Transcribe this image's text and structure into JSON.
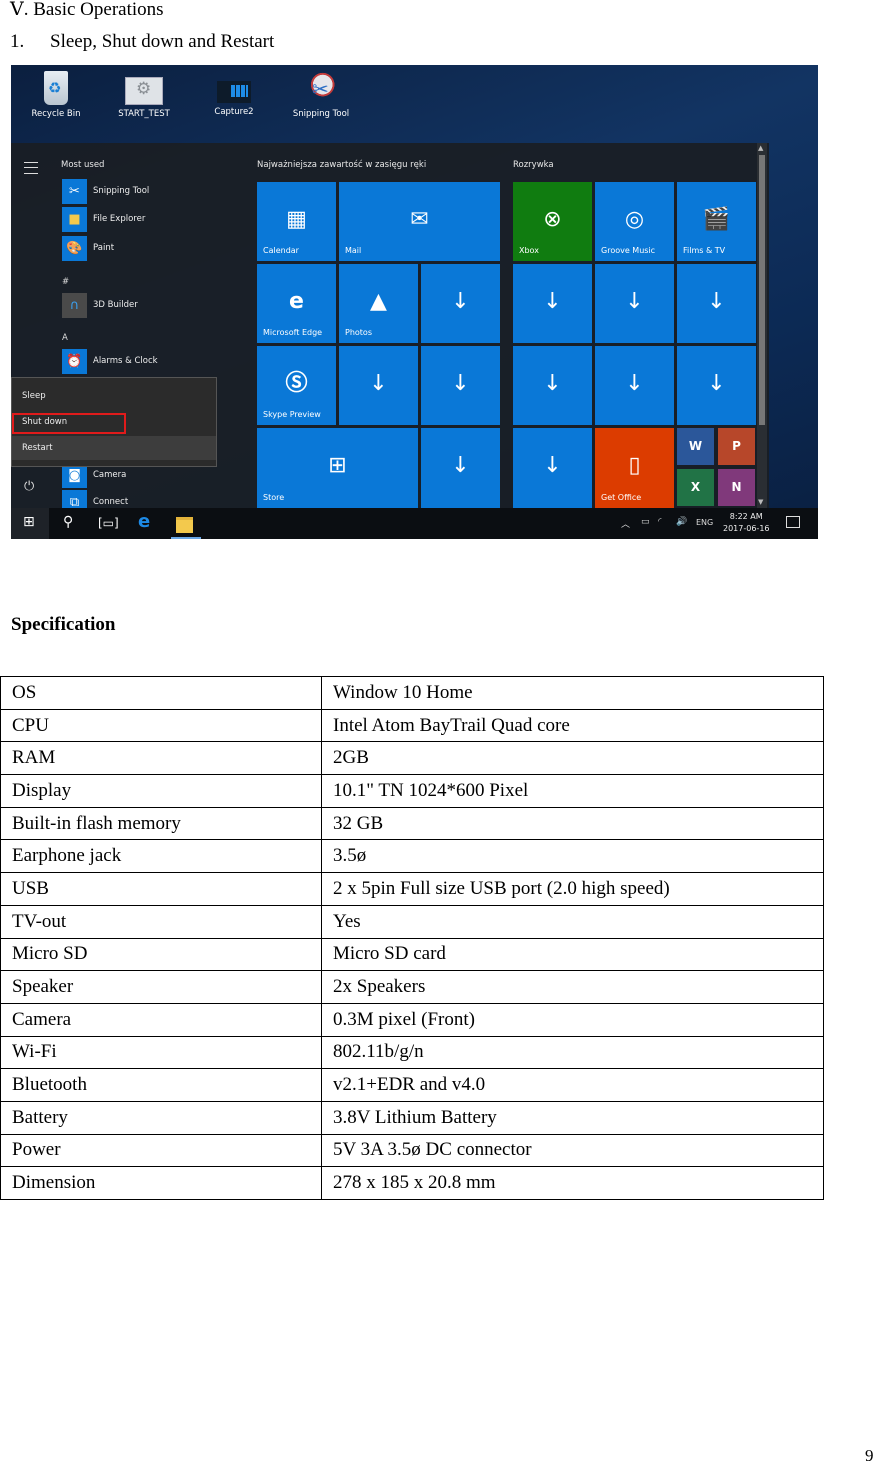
{
  "doc": {
    "section_heading": "Ⅴ. Basic Operations",
    "subsection_number": "1.",
    "subsection_title": "Sleep, Shut down and Restart",
    "spec_title": "Specification",
    "page_number": "9"
  },
  "screenshot": {
    "desktop_icons": [
      {
        "label": "Recycle Bin",
        "icon": "recycle-bin-icon"
      },
      {
        "label": "START_TEST",
        "icon": "settings-window-icon"
      },
      {
        "label": "Capture2",
        "icon": "image-file-icon"
      },
      {
        "label": "Snipping Tool",
        "icon": "snipping-tool-icon"
      }
    ],
    "start_menu": {
      "most_used_label": "Most used",
      "apps": [
        {
          "label": "Snipping Tool",
          "icon": "snipping-tool-icon"
        },
        {
          "label": "File Explorer",
          "icon": "folder-icon"
        },
        {
          "label": "Paint",
          "icon": "paint-icon"
        },
        {
          "label": "3D Builder",
          "icon": "3d-builder-icon"
        },
        {
          "label": "Alarms & Clock",
          "icon": "alarm-clock-icon"
        },
        {
          "label": "Camera",
          "icon": "camera-icon"
        },
        {
          "label": "Connect",
          "icon": "connect-icon"
        }
      ],
      "letters": [
        "#",
        "A"
      ],
      "power_menu": {
        "items": [
          "Sleep",
          "Shut down",
          "Restart"
        ],
        "highlighted": "Shut down",
        "highlight_color": "#e01b1b"
      },
      "groups": [
        {
          "title": "Najważniejsza zawartość w zasięgu ręki"
        },
        {
          "title": "Rozrywka"
        }
      ],
      "tiles": {
        "calendar": "Calendar",
        "mail": "Mail",
        "edge": "Microsoft Edge",
        "photos": "Photos",
        "skype": "Skype Preview",
        "store": "Store",
        "xbox": "Xbox",
        "groove": "Groove Music",
        "films": "Films & TV",
        "office": "Get Office",
        "download_glyph": "↓"
      },
      "office_minis": [
        "W",
        "P",
        "X",
        "N"
      ],
      "colors": {
        "tile_blue": "#0a78d7",
        "xbox_green": "#107c10",
        "office_orange": "#dc3c00",
        "word": "#2b579a",
        "powerpoint": "#b7472a",
        "excel": "#217346",
        "onenote": "#80397b"
      }
    },
    "taskbar": {
      "language": "ENG",
      "time": "8:22 AM",
      "date": "2017-06-16"
    }
  },
  "spec_table": {
    "rows": [
      {
        "key": "OS",
        "value": "Window 10 Home"
      },
      {
        "key": "CPU",
        "value": "Intel Atom BayTrail Quad core"
      },
      {
        "key": "RAM",
        "value": "2GB"
      },
      {
        "key": "Display",
        "value": "10.1\" TN 1024*600 Pixel"
      },
      {
        "key": "Built-in flash memory",
        "value": "32 GB"
      },
      {
        "key": "Earphone jack",
        "value": "3.5ø"
      },
      {
        "key": "USB",
        "value": "2 x 5pin Full size USB port (2.0 high speed)"
      },
      {
        "key": "TV-out",
        "value": "Yes"
      },
      {
        "key": "Micro SD",
        "value": "Micro SD card"
      },
      {
        "key": "Speaker",
        "value": "2x Speakers"
      },
      {
        "key": "Camera",
        "value": "0.3M pixel (Front)"
      },
      {
        "key": "Wi-Fi",
        "value": "802.11b/g/n"
      },
      {
        "key": "Bluetooth",
        "value": "v2.1+EDR and v4.0"
      },
      {
        "key": "Battery",
        "value": "3.8V Lithium Battery"
      },
      {
        "key": "Power",
        "value": "5V 3A 3.5ø DC connector"
      },
      {
        "key": "Dimension",
        "value": "278 x 185 x 20.8 mm"
      }
    ]
  }
}
